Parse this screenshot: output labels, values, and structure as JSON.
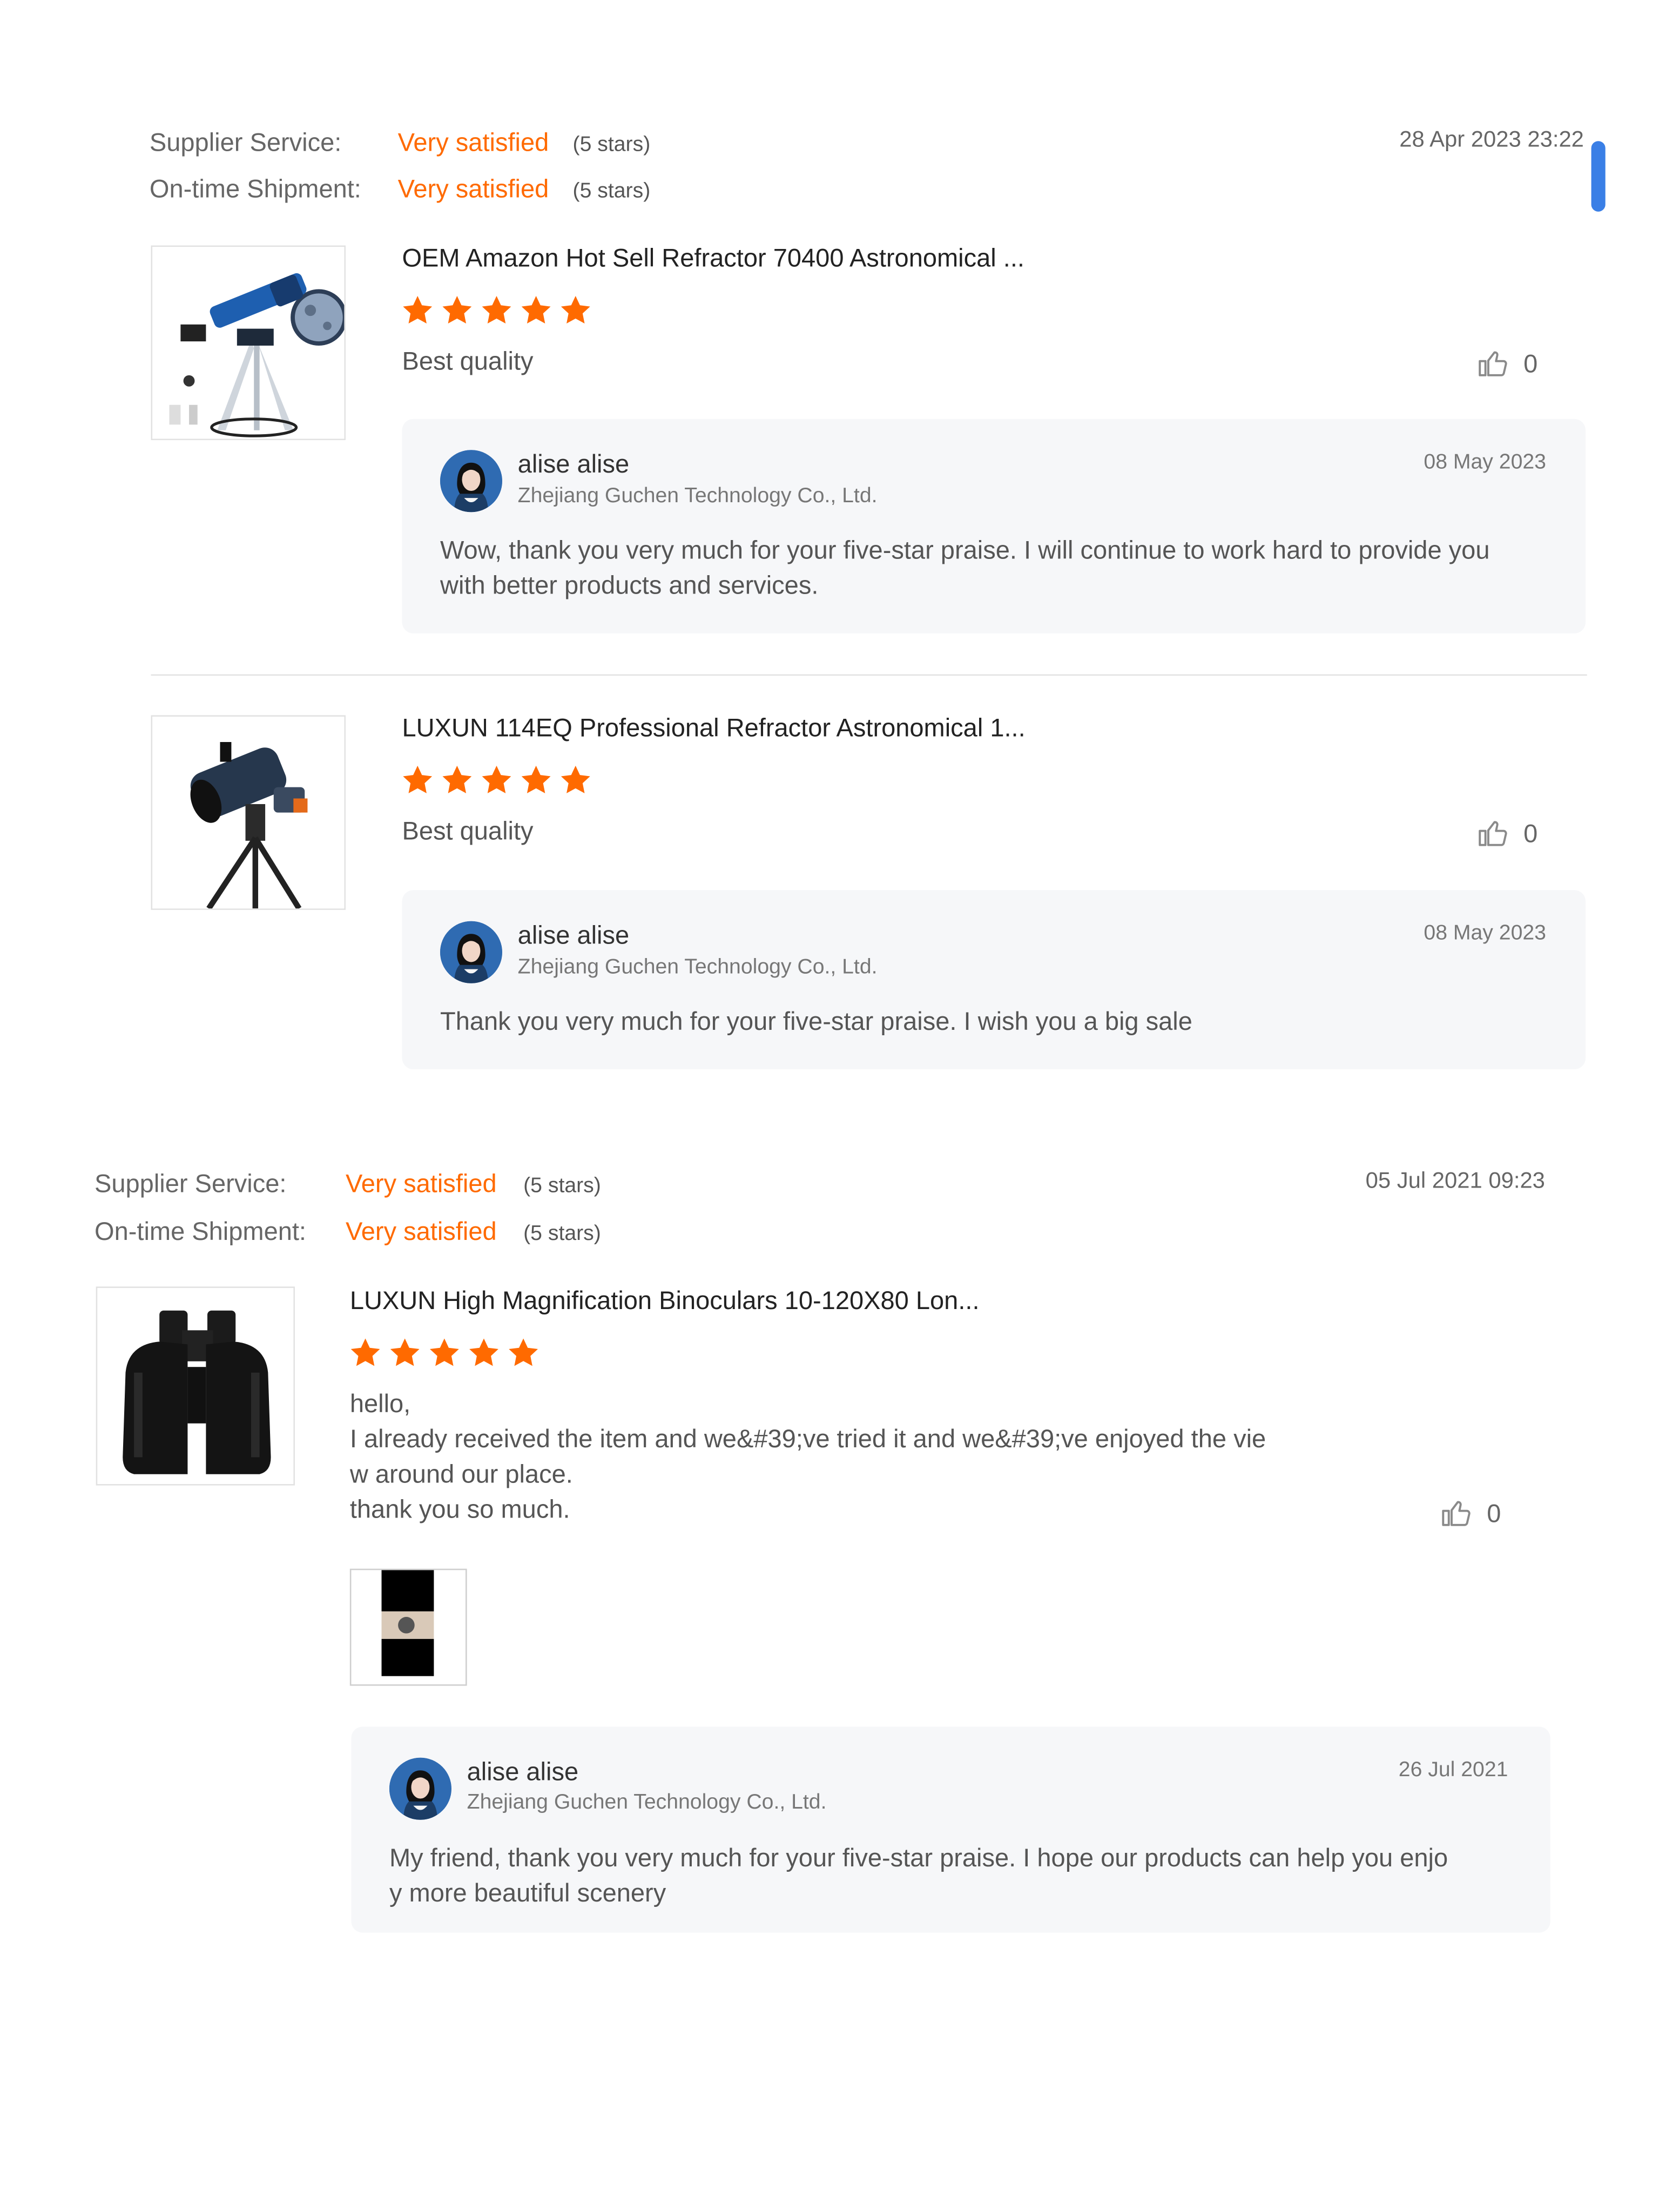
{
  "reviews": [
    {
      "supplier_label": "Supplier Service:",
      "supplier_value": "Very satisfied",
      "supplier_count": "(5 stars)",
      "shipment_label": "On-time Shipment:",
      "shipment_value": "Very satisfied",
      "shipment_count": "(5 stars)",
      "date": "28 Apr 2023 23:22",
      "items": [
        {
          "title": "OEM Amazon Hot Sell Refractor 70400 Astronomical ...",
          "rating": 5,
          "text": "Best quality",
          "likes": "0",
          "reply": {
            "name": "alise alise",
            "company": "Zhejiang Guchen Technology Co., Ltd.",
            "date": "08 May 2023",
            "line1": "Wow, thank you very much for your five-star praise. I will continue to work hard to provide you",
            "line2": "with better products and services."
          }
        },
        {
          "title": "LUXUN 114EQ Professional Refractor Astronomical 1...",
          "rating": 5,
          "text": "Best quality",
          "likes": "0",
          "reply": {
            "name": "alise alise",
            "company": "Zhejiang Guchen Technology Co., Ltd.",
            "date": "08 May 2023",
            "line1": "Thank you very much for your five-star praise. I wish you a big sale"
          }
        }
      ]
    },
    {
      "supplier_label": "Supplier Service:",
      "supplier_value": "Very satisfied",
      "supplier_count": "(5 stars)",
      "shipment_label": "On-time Shipment:",
      "shipment_value": "Very satisfied",
      "shipment_count": "(5 stars)",
      "date": "05 Jul 2021 09:23",
      "items": [
        {
          "title": "LUXUN High Magnification Binoculars 10-120X80 Lon...",
          "rating": 5,
          "text_lines": [
            "hello,",
            "I already received the item and we&#39;ve tried it and we&#39;ve enjoyed the vie",
            "w around our  place.",
            "thank you so much."
          ],
          "likes": "0",
          "reply": {
            "name": "alise alise",
            "company": "Zhejiang Guchen Technology Co., Ltd.",
            "date": "26 Jul 2021",
            "line1": "My friend, thank you very much for your five-star praise. I hope our products can help you enjo",
            "line2": "y more beautiful scenery"
          }
        }
      ]
    }
  ],
  "icons": {
    "star": "star-icon",
    "like": "thumbs-up-icon"
  },
  "colors": {
    "accent": "#ff6a00",
    "reply_bg": "#f6f7f9",
    "scroll": "#3a7fe6"
  }
}
